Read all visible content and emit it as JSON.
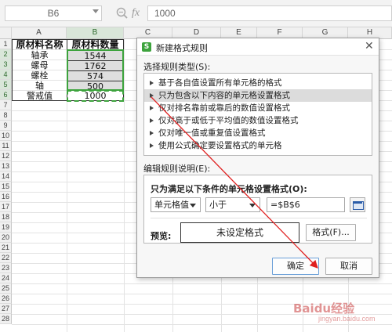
{
  "formula_bar": {
    "cell_ref": "B6",
    "fx": "fx",
    "formula": "1000"
  },
  "columns": [
    "A",
    "B",
    "C",
    "D",
    "E",
    "F",
    "G",
    "H"
  ],
  "rows": [
    "1",
    "2",
    "3",
    "4",
    "5",
    "6",
    "7",
    "8",
    "9",
    "10",
    "11",
    "12",
    "13",
    "14",
    "15",
    "16",
    "17",
    "18",
    "19",
    "20",
    "21",
    "22",
    "23",
    "24",
    "25",
    "26",
    "27",
    "28"
  ],
  "table": {
    "header": [
      "原材料名称",
      "原材料数量"
    ],
    "rows": [
      [
        "轴承",
        "1544"
      ],
      [
        "螺母",
        "1762"
      ],
      [
        "螺栓",
        "574"
      ],
      [
        "轴",
        "500"
      ],
      [
        "警戒值",
        "1000"
      ]
    ]
  },
  "dialog": {
    "title": "新建格式规则",
    "rule_type_label": "选择规则类型(S):",
    "rule_types": [
      "基于各自值设置所有单元格的格式",
      "只为包含以下内容的单元格设置格式",
      "仅对排名靠前或靠后的数值设置格式",
      "仅对高于或低于平均值的数值设置格式",
      "仅对唯一值或重复值设置格式",
      "使用公式确定要设置格式的单元格"
    ],
    "edit_desc_label": "编辑规则说明(E):",
    "condition_label": "只为满足以下条件的单元格设置格式(O):",
    "combo1": "单元格值",
    "combo2": "小于",
    "value": "=$B$6",
    "preview_label": "预览:",
    "preview_text": "未设定格式",
    "format_button": "格式(F)...",
    "ok": "确定",
    "cancel": "取消"
  },
  "watermark": {
    "main": "Baidu经验",
    "sub": "jingyan.baidu.com"
  },
  "colors": {
    "accent_green": "#3da33d",
    "annotation_red": "#e02020"
  }
}
